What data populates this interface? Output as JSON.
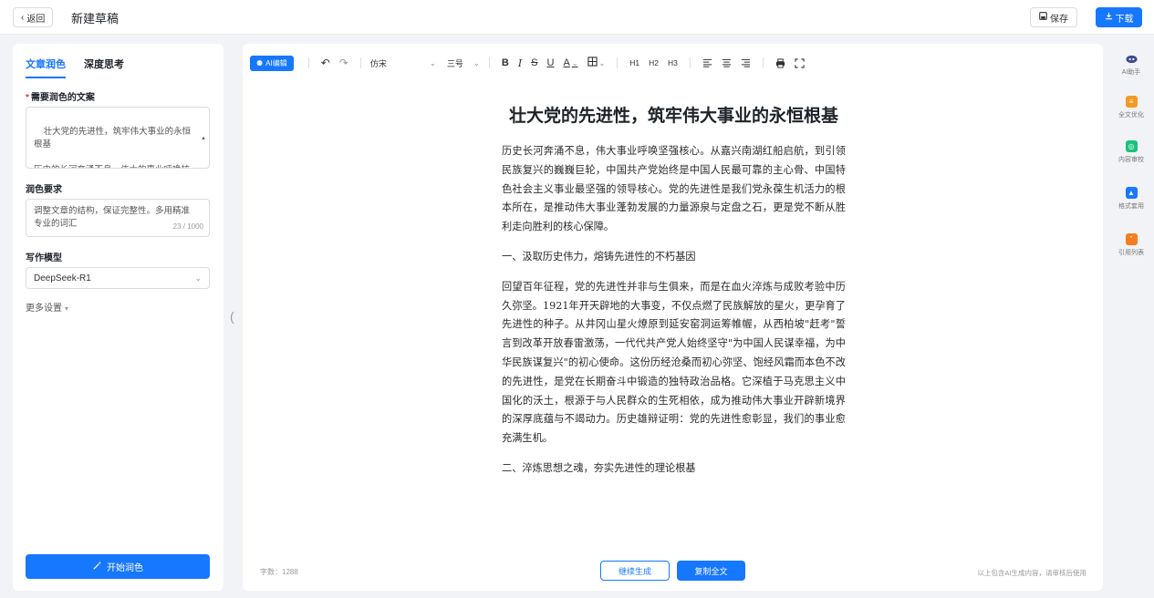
{
  "header": {
    "back_label": "返回",
    "title": "新建草稿",
    "save_label": "保存",
    "download_label": "下载"
  },
  "left_panel": {
    "tabs": [
      {
        "label": "文章润色",
        "active": true
      },
      {
        "label": "深度思考",
        "active": false
      }
    ],
    "source_label": "需要润色的文案",
    "source_text": "壮大党的先进性，筑牢伟大事业的永恒根基\n\n历史的长河奔涌不息，伟大的事业呼唤核心。从嘉兴南湖的红船启航，到引领中华民族伟大复兴的巍巍巨轮，中国共产党始终是",
    "requirement_label": "润色要求",
    "requirement_text": "调整文章的结构，保证完整性。多用精准专业的词汇",
    "requirement_counter": "23 / 1000",
    "model_label": "写作模型",
    "model_value": "DeepSeek-R1",
    "more_settings_label": "更多设置",
    "start_label": "开始润色"
  },
  "toolbar": {
    "ai_edit_label": "AI编辑",
    "font_family": "仿宋",
    "font_size": "三号",
    "bold": "B",
    "italic": "I",
    "strike": "S",
    "underline": "U",
    "color": "A",
    "h1": "H1",
    "h2": "H2",
    "h3": "H3"
  },
  "document": {
    "title": "壮大党的先进性，筑牢伟大事业的永恒根基",
    "paragraphs": [
      "历史长河奔涌不息，伟大事业呼唤坚强核心。从嘉兴南湖红船启航，到引领民族复兴的巍巍巨轮，中国共产党始终是中国人民最可靠的主心骨、中国特色社会主义事业最坚强的领导核心。党的先进性是我们党永葆生机活力的根本所在，是推动伟大事业蓬勃发展的力量源泉与定盘之石，更是党不断从胜利走向胜利的核心保障。",
      "一、汲取历史伟力，熔铸先进性的不朽基因",
      "回望百年征程，党的先进性并非与生俱来，而是在血火淬炼与成败考验中历久弥坚。1921年开天辟地的大事变，不仅点燃了民族解放的星火，更孕育了先进性的种子。从井冈山星火燎原到延安窑洞运筹帷幄，从西柏坡\"赶考\"誓言到改革开放春雷激荡，一代代共产党人始终坚守\"为中国人民谋幸福，为中华民族谋复兴\"的初心使命。这份历经沧桑而初心弥坚、饱经风霜而本色不改的先进性，是党在长期奋斗中锻造的独特政治品格。它深植于马克思主义中国化的沃土，根源于与人民群众的生死相依，成为推动伟大事业开辟新境界的深厚底蕴与不竭动力。历史雄辩证明：党的先进性愈彰显，我们的事业愈充满生机。",
      "二、淬炼思想之魂，夯实先进性的理论根基"
    ],
    "word_count": "字数：1288",
    "continue_label": "继续生成",
    "copy_label": "复制全文",
    "disclaimer": "以上包含AI生成内容，请审核后使用"
  },
  "right_bar": {
    "items": [
      {
        "label": "AI助手",
        "color": "#3d4b8f"
      },
      {
        "label": "全文优化",
        "color": "#f59a23"
      },
      {
        "label": "内容审校",
        "color": "#19c37d"
      },
      {
        "label": "格式套用",
        "color": "#1677ff"
      },
      {
        "label": "引用列表",
        "color": "#f57c1f"
      }
    ]
  },
  "colors": {
    "primary": "#1677ff",
    "background": "#f2f3f6"
  }
}
